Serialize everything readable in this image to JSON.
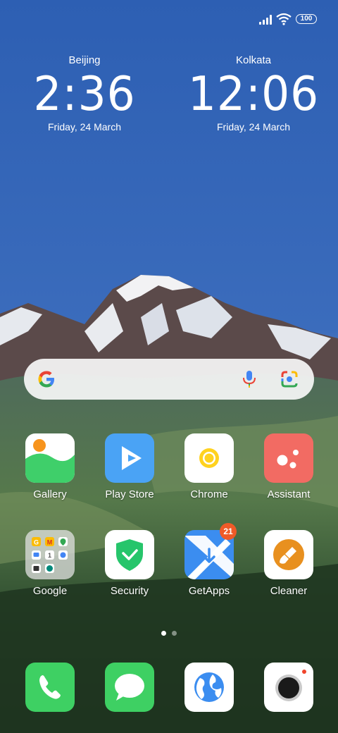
{
  "status_bar": {
    "battery_level": "100",
    "signal_icon": "cell-signal-icon",
    "wifi_icon": "wifi-icon"
  },
  "clocks": [
    {
      "city": "Beijing",
      "time": "2:36",
      "date": "Friday, 24 March"
    },
    {
      "city": "Kolkata",
      "time": "12:06",
      "date": "Friday, 24 March"
    }
  ],
  "search": {
    "logo_icon": "google-g-icon",
    "voice_icon": "microphone-icon",
    "lens_icon": "google-lens-icon"
  },
  "apps": [
    {
      "label": "Gallery",
      "icon": "gallery-icon"
    },
    {
      "label": "Play Store",
      "icon": "play-store-icon"
    },
    {
      "label": "Chrome",
      "icon": "chrome-icon"
    },
    {
      "label": "Assistant",
      "icon": "assistant-icon"
    },
    {
      "label": "Google",
      "icon": "google-folder-icon"
    },
    {
      "label": "Security",
      "icon": "security-shield-icon"
    },
    {
      "label": "GetApps",
      "icon": "getapps-icon",
      "badge": "21"
    },
    {
      "label": "Cleaner",
      "icon": "cleaner-brush-icon"
    }
  ],
  "page_indicator": {
    "pages": 2,
    "current": 1
  },
  "dock": [
    {
      "icon": "phone-icon"
    },
    {
      "icon": "messages-icon"
    },
    {
      "icon": "browser-icon"
    },
    {
      "icon": "camera-icon"
    }
  ],
  "colors": {
    "sky": "#2f64b7",
    "badge": "#f05a28",
    "gallery_green": "#3fcf6a",
    "play_blue": "#4aa3f5",
    "assistant_red": "#f26b63",
    "security_green": "#26c56b",
    "getapps_blue": "#3b8df0",
    "cleaner_orange": "#e8901f",
    "phone_green": "#3ed063"
  }
}
